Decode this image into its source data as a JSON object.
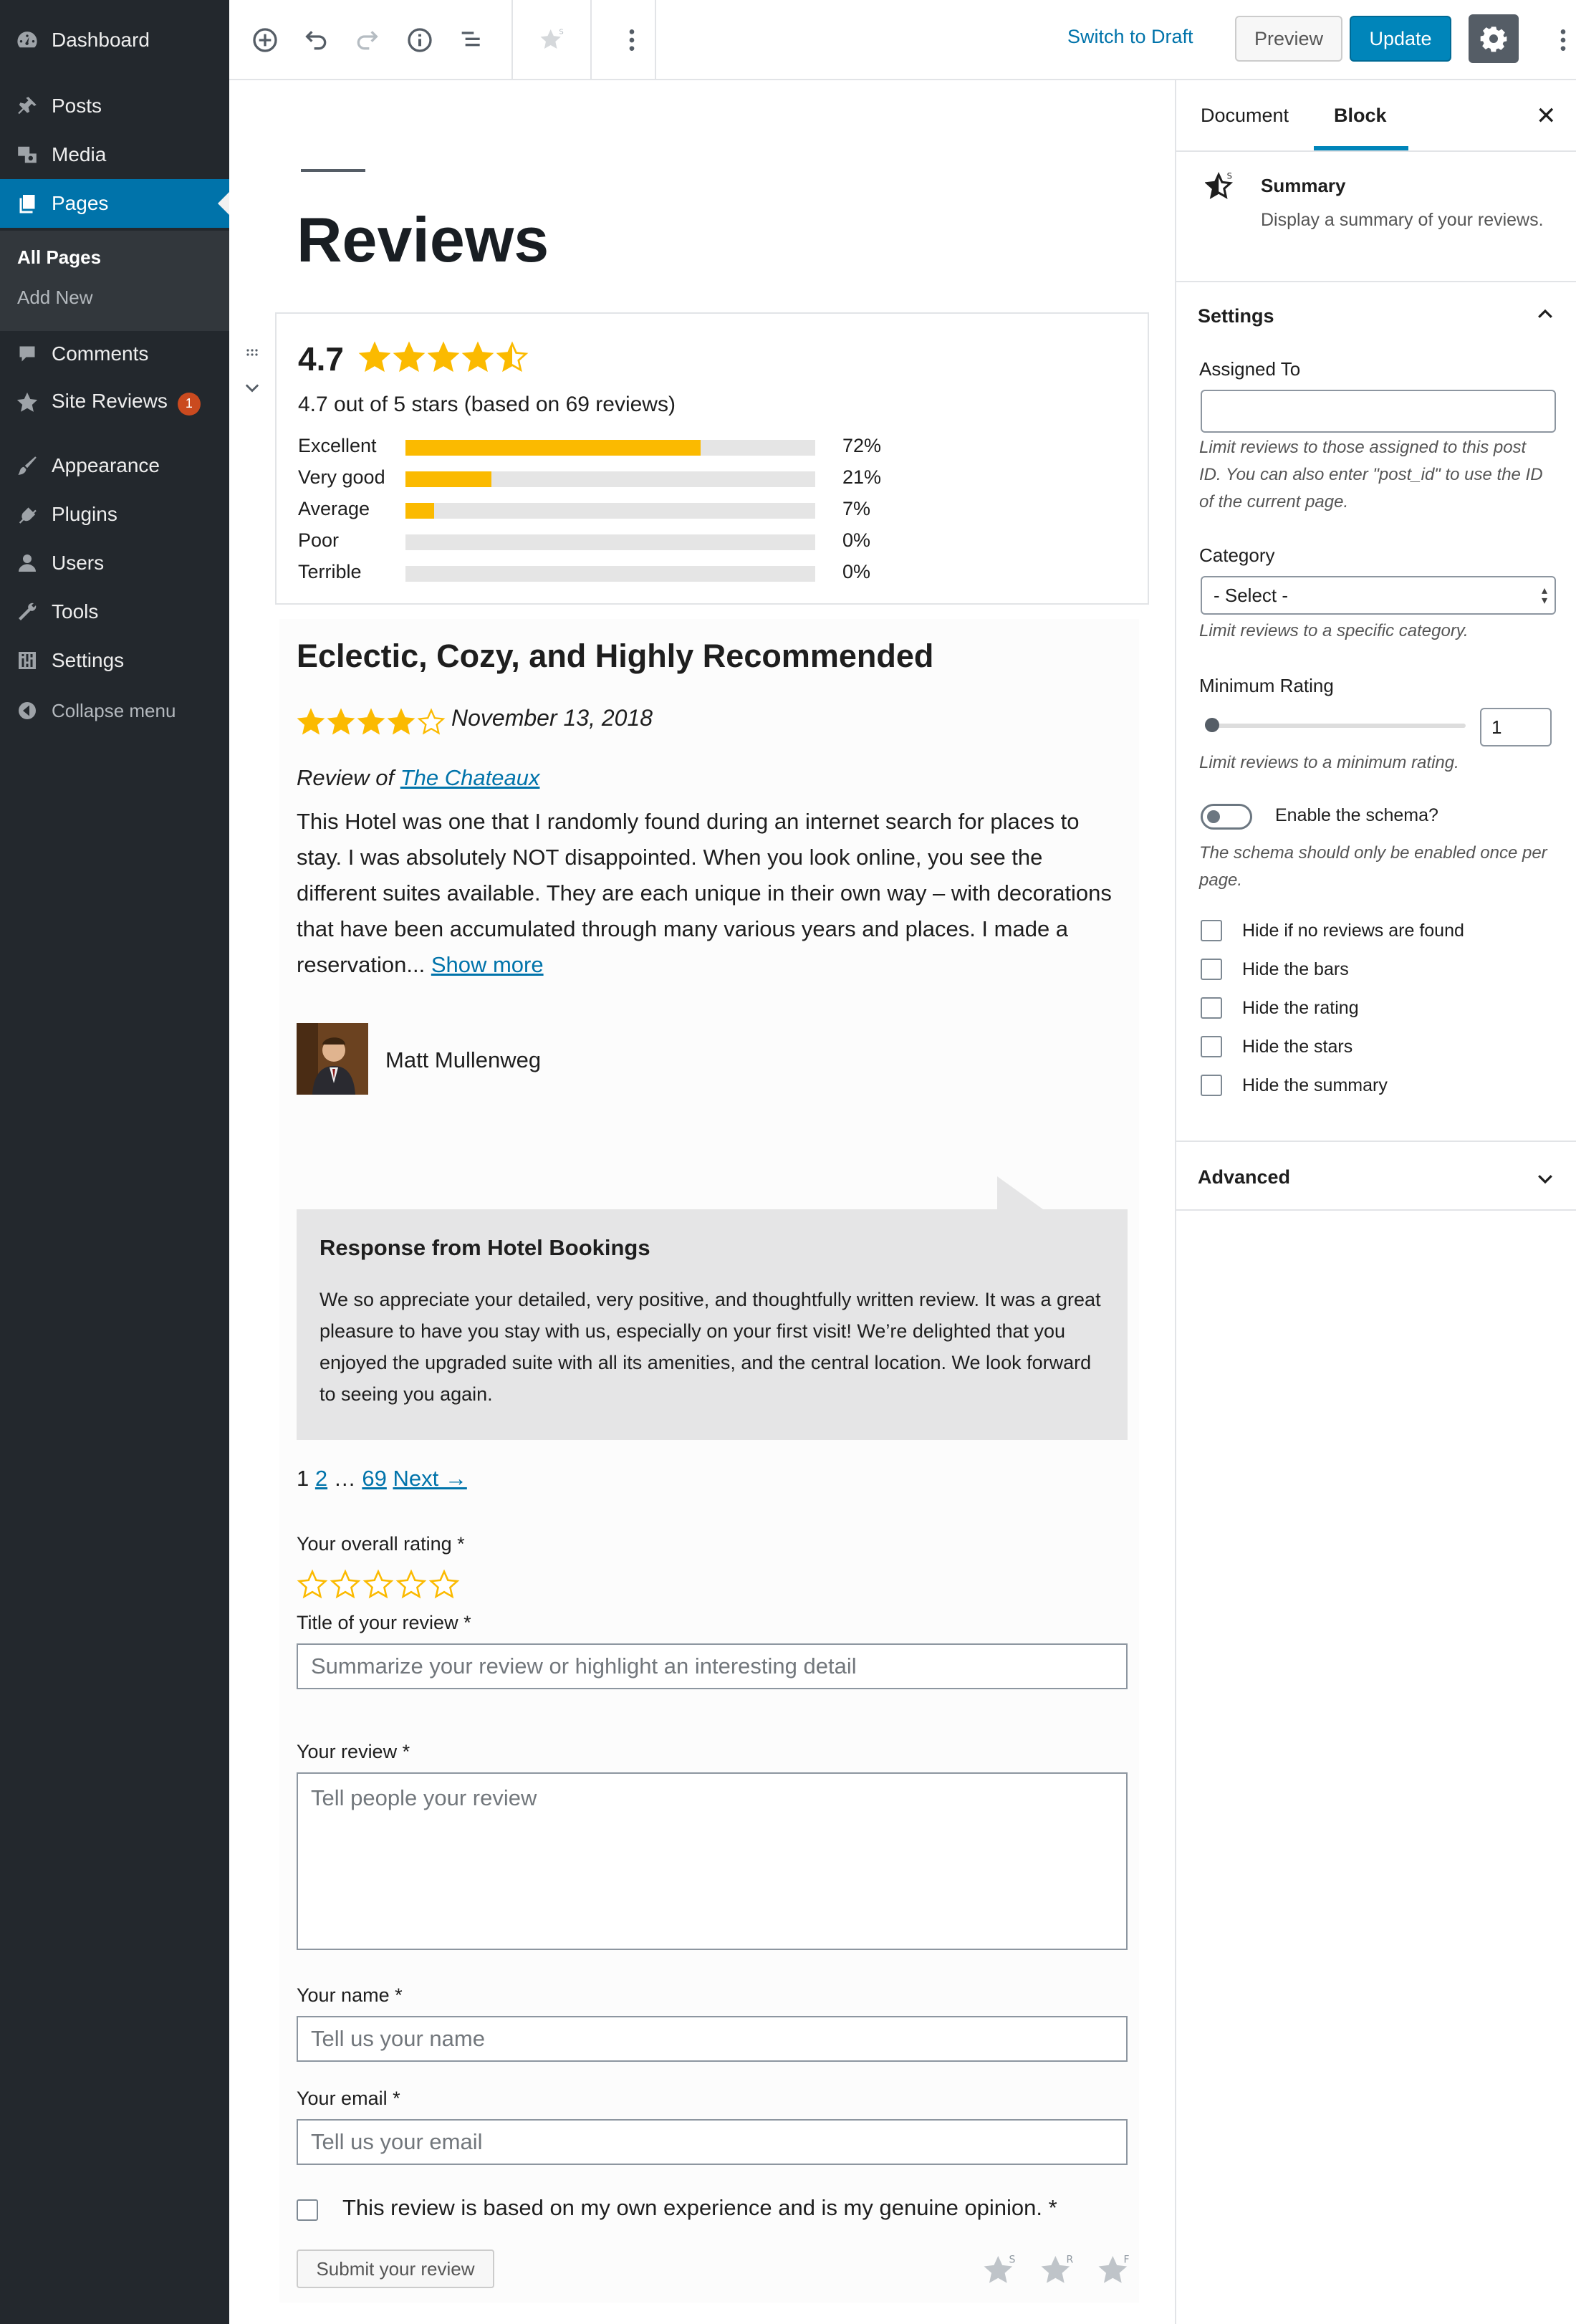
{
  "admin_menu": {
    "items": [
      {
        "label": "Dashboard",
        "icon": "dashboard-icon"
      },
      {
        "label": "Posts",
        "icon": "pin-icon"
      },
      {
        "label": "Media",
        "icon": "media-icon"
      },
      {
        "label": "Pages",
        "icon": "pages-icon"
      },
      {
        "label": "Comments",
        "icon": "comment-icon"
      },
      {
        "label": "Site Reviews",
        "icon": "star-icon",
        "badge": "1"
      },
      {
        "label": "Appearance",
        "icon": "brush-icon"
      },
      {
        "label": "Plugins",
        "icon": "plug-icon"
      },
      {
        "label": "Users",
        "icon": "user-icon"
      },
      {
        "label": "Tools",
        "icon": "wrench-icon"
      },
      {
        "label": "Settings",
        "icon": "sliders-icon"
      }
    ],
    "pages_submenu": [
      "All Pages",
      "Add New"
    ],
    "collapse": "Collapse menu"
  },
  "toolbar": {
    "switch_draft": "Switch to Draft",
    "preview": "Preview",
    "update": "Update"
  },
  "editor": {
    "page_title": "Reviews"
  },
  "summary": {
    "rating": "4.7",
    "stars": 4.7,
    "text": "4.7 out of 5 stars (based on 69 reviews)",
    "bars": [
      {
        "label": "Excellent",
        "pct": "72%",
        "value": 72
      },
      {
        "label": "Very good",
        "pct": "21%",
        "value": 21
      },
      {
        "label": "Average",
        "pct": "7%",
        "value": 7
      },
      {
        "label": "Poor",
        "pct": "0%",
        "value": 0
      },
      {
        "label": "Terrible",
        "pct": "0%",
        "value": 0
      }
    ],
    "star_color": "#fbba00"
  },
  "review": {
    "title": "Eclectic, Cozy, and Highly Recommended",
    "stars": 4,
    "date": "November 13, 2018",
    "review_of_prefix": "Review of ",
    "review_of_link": "The Chateaux",
    "body": "This Hotel was one that I randomly found during an internet search for places to stay. I was absolutely NOT disappointed. When you look online, you see the different suites available. They are each unique in their own way – with decorations that have been accumulated through many various years and places. I made a reservation... ",
    "show_more": "Show more",
    "author": "Matt Mullenweg",
    "response_title": "Response from Hotel Bookings",
    "response_body": "We so appreciate your detailed, very positive, and thoughtfully written review. It was a great pleasure to have you stay with us, especially on your first visit! We’re delighted that you enjoyed the upgraded suite with all its amenities, and the central location. We look forward to seeing you again."
  },
  "pagination": {
    "current": "1",
    "page2": "2",
    "ellipsis": " … ",
    "last": "69",
    "next": "Next →"
  },
  "form": {
    "rating_label": "Your overall rating *",
    "title_label": "Title of your review *",
    "title_placeholder": "Summarize your review or highlight an interesting detail",
    "review_label": "Your review *",
    "review_placeholder": "Tell people your review",
    "name_label": "Your name *",
    "name_placeholder": "Tell us your name",
    "email_label": "Your email *",
    "email_placeholder": "Tell us your email",
    "consent": "This review is based on my own experience and is my genuine opinion. *",
    "submit": "Submit your review"
  },
  "panel": {
    "tab_document": "Document",
    "tab_block": "Block",
    "close": "✕",
    "block_title": "Summary",
    "block_desc": "Display a summary of your reviews.",
    "settings_header": "Settings",
    "assigned_label": "Assigned To",
    "assigned_help": "Limit reviews to those assigned to this post ID. You can also enter \"post_id\" to use the ID of the current page.",
    "category_label": "Category",
    "category_value": "- Select -",
    "category_help": "Limit reviews to a specific category.",
    "min_rating_label": "Minimum Rating",
    "min_rating_value": "1",
    "min_rating_help": "Limit reviews to a minimum rating.",
    "schema_label": "Enable the schema?",
    "schema_help": "The schema should only be enabled once per page.",
    "checkboxes": [
      "Hide if no reviews are found",
      "Hide the bars",
      "Hide the rating",
      "Hide the stars",
      "Hide the summary"
    ],
    "advanced_header": "Advanced"
  }
}
